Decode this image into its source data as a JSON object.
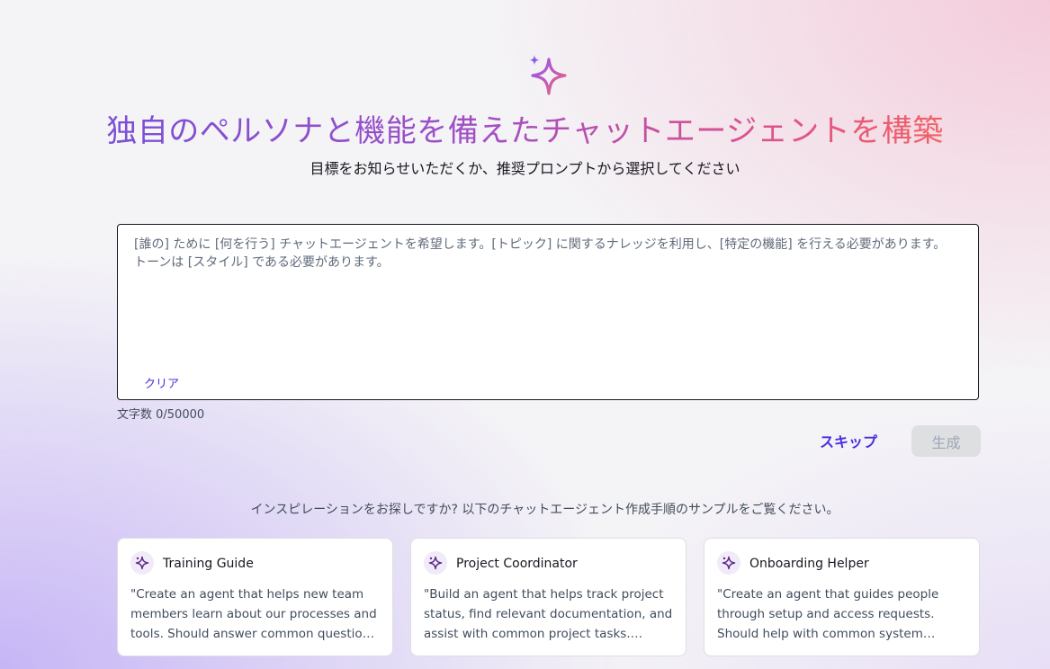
{
  "header": {
    "title": "独自のペルソナと機能を備えたチャットエージェントを構築",
    "subtitle": "目標をお知らせいただくか、推奨プロンプトから選択してください"
  },
  "prompt": {
    "placeholder": "[誰の] ために [何を行う] チャットエージェントを希望します。[トピック] に関するナレッジを利用し、[特定の機能] を行える必要があります。トーンは [スタイル] である必要があります。",
    "value": "",
    "clear_label": "クリア",
    "char_count": "文字数 0/50000"
  },
  "actions": {
    "skip_label": "スキップ",
    "generate_label": "生成"
  },
  "inspiration": {
    "text": "インスピレーションをお探しですか? 以下のチャットエージェント作成手順のサンプルをご覧ください。",
    "cards": [
      {
        "icon": "sparkle-icon",
        "title": "Training Guide",
        "description": "\"Create an agent that helps new team members learn about our processes and tools. Should answer common questions and point to relevant documentation.\""
      },
      {
        "icon": "sparkle-icon",
        "title": "Project Coordinator",
        "description": "\"Build an agent that helps track project status, find relevant documentation, and assist with common project tasks. Should be concise and action oriented.\""
      },
      {
        "icon": "sparkle-icon",
        "title": "Onboarding Helper",
        "description": "\"Create an agent that guides people through setup and access requests. Should help with common system access questions.\""
      }
    ]
  },
  "colors": {
    "accent": "#4a2ee0",
    "title_gradient_start": "#7a4fd6",
    "title_gradient_end": "#f06265",
    "disabled_button": "#dedfe1"
  }
}
